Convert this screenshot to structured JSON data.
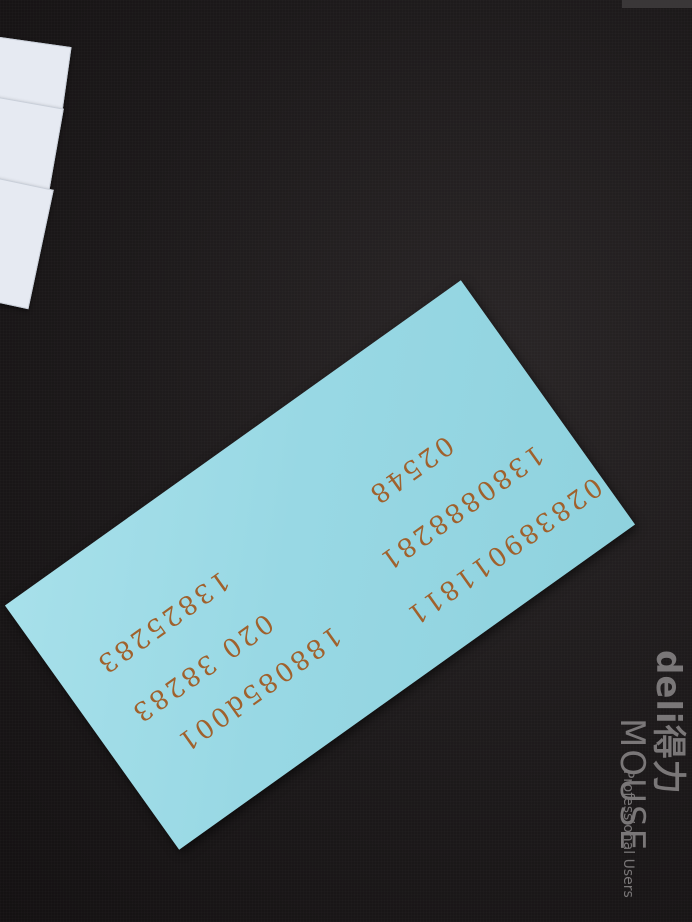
{
  "note": {
    "lines_left": [
      "188085d001",
      "020 38283",
      "13825283"
    ],
    "lines_right": [
      "028389011811",
      "1380888281",
      "02548"
    ]
  },
  "brand": {
    "logo": "deli得力",
    "subtitle": "Professional Users",
    "product": "MOUSE"
  }
}
